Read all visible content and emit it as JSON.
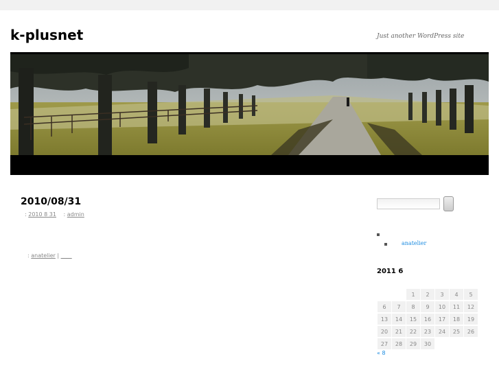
{
  "site": {
    "title": "k-plusnet",
    "description": "Just another WordPress site"
  },
  "post": {
    "title": "2010/08/31",
    "meta_prefix": ":",
    "date_link": "2010 8 31",
    "author_prefix": ":",
    "author_link": "admin",
    "footer_prefix": ":",
    "category_link": "anatelier",
    "footer_separator": "|",
    "comments_link": "____"
  },
  "sidebar": {
    "link": "anatelier",
    "calendar": {
      "caption": "2011  6",
      "rows": [
        [
          "",
          "",
          "1",
          "2",
          "3",
          "4",
          "5"
        ],
        [
          "6",
          "7",
          "8",
          "9",
          "10",
          "11",
          "12"
        ],
        [
          "13",
          "14",
          "15",
          "16",
          "17",
          "18",
          "19"
        ],
        [
          "20",
          "21",
          "22",
          "23",
          "24",
          "25",
          "26"
        ],
        [
          "27",
          "28",
          "29",
          "30",
          "",
          "",
          ""
        ]
      ],
      "prev_link": "« 8"
    }
  }
}
